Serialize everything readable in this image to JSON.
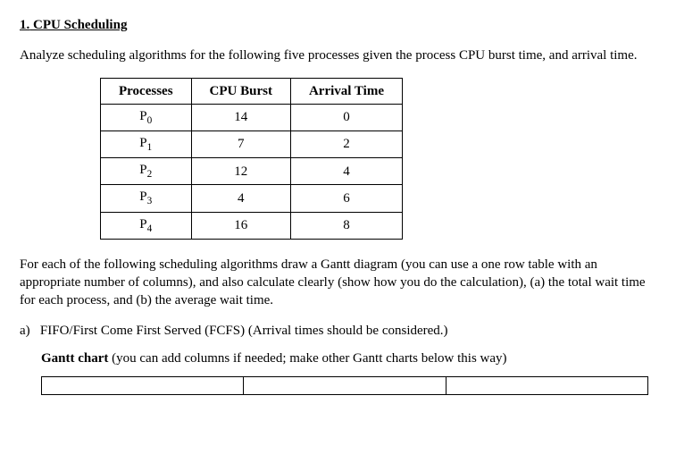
{
  "heading_num": "1.",
  "heading_title": "CPU Scheduling",
  "intro": "Analyze scheduling algorithms for the following five processes given the process CPU burst time, and arrival time.",
  "table": {
    "headers": [
      "Processes",
      "CPU Burst",
      "Arrival Time"
    ],
    "rows": [
      {
        "p_name": "P",
        "p_sub": "0",
        "burst": "14",
        "arrival": "0"
      },
      {
        "p_name": "P",
        "p_sub": "1",
        "burst": "7",
        "arrival": "2"
      },
      {
        "p_name": "P",
        "p_sub": "2",
        "burst": "12",
        "arrival": "4"
      },
      {
        "p_name": "P",
        "p_sub": "3",
        "burst": "4",
        "arrival": "6"
      },
      {
        "p_name": "P",
        "p_sub": "4",
        "burst": "16",
        "arrival": "8"
      }
    ]
  },
  "instructions": "For each of the following scheduling algorithms draw a Gantt diagram (you can use a one row table with an appropriate number of columns), and also calculate clearly (show how you do the calculation), (a) the total wait time for each process, and (b) the average wait time.",
  "part_a_label": "a)",
  "part_a_text": "FIFO/First Come First Served (FCFS) (Arrival times should be considered.)",
  "gantt_label": "Gantt chart",
  "gantt_paren": "(you can add columns if needed; make other Gantt charts below this way)",
  "chart_data": {
    "type": "table",
    "title": "Process CPU Burst and Arrival Time",
    "columns": [
      "Processes",
      "CPU Burst",
      "Arrival Time"
    ],
    "series": [
      {
        "name": "P0",
        "values": [
          14,
          0
        ]
      },
      {
        "name": "P1",
        "values": [
          7,
          2
        ]
      },
      {
        "name": "P2",
        "values": [
          12,
          4
        ]
      },
      {
        "name": "P3",
        "values": [
          4,
          6
        ]
      },
      {
        "name": "P4",
        "values": [
          16,
          8
        ]
      }
    ]
  }
}
